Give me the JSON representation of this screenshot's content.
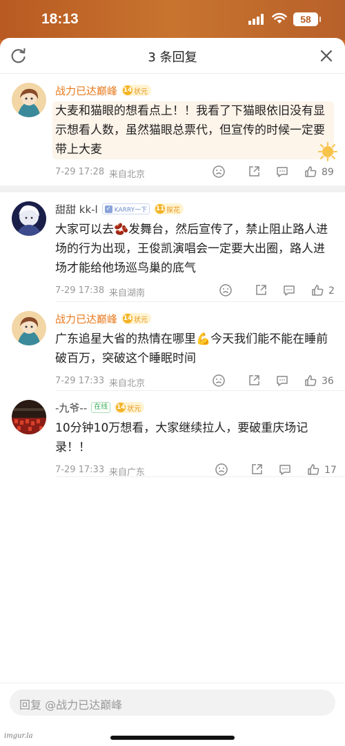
{
  "status_bar": {
    "time": "18:13",
    "battery": "58"
  },
  "sheet": {
    "title": "3 条回复"
  },
  "comments": [
    {
      "username": "战力已达巅峰",
      "level": "14",
      "level_title": "状元",
      "text": "大麦和猫眼的想看点上！！我看了下猫眼依旧没有显示想看人数，虽然猫眼总票代，但宣传的时候一定要带上大麦",
      "date": "7-29 17:28",
      "location": "来自北京",
      "likes": "89"
    },
    {
      "username": "甜甜 kk-l",
      "verify": "KARRY一下",
      "level": "11",
      "level_title": "探花",
      "text": "大家可以去🫘发舞台，然后宣传了，禁止阻止路人进场的行为出现，王俊凯演唱会一定要大出圈，路人进场才能给他场巡鸟巢的底气",
      "date": "7-29 17:38",
      "location": "来自湖南",
      "likes": "2"
    },
    {
      "username": "战力已达巅峰",
      "level": "14",
      "level_title": "状元",
      "text": "广东追星大省的热情在哪里💪今天我们能不能在睡前破百万，突破这个睡眠时间",
      "date": "7-29 17:33",
      "location": "来自北京",
      "likes": "36"
    },
    {
      "username": "-九爷--",
      "online": "在线",
      "level": "14",
      "level_title": "状元",
      "text": "10分钟10万想看，大家继续拉人，要破重庆场记录！！",
      "date": "7-29 17:33",
      "location": "来自广东",
      "likes": "17"
    }
  ],
  "reply_box": {
    "placeholder": "回复 @战力已达巅峰"
  },
  "watermark": "imgur.la"
}
